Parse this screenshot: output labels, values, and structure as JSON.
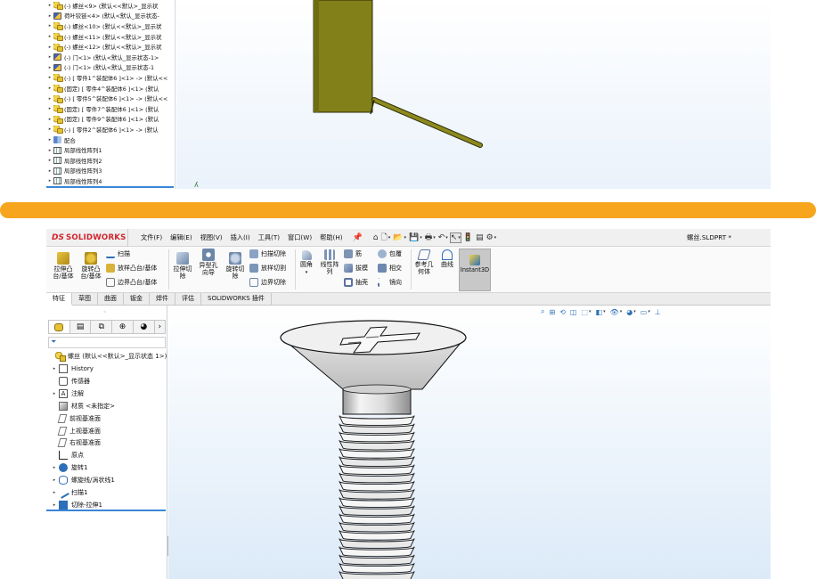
{
  "top_tree": {
    "items": [
      {
        "icon": "bolt",
        "text": "(-) 螺丝<9> (默认<<默认>_显示状"
      },
      {
        "icon": "asm",
        "text": "荷叶铰链<4> (默认<默认_显示状态-"
      },
      {
        "icon": "bolt",
        "text": "(-) 螺丝<10> (默认<<默认>_显示状"
      },
      {
        "icon": "bolt",
        "text": "(-) 螺丝<11> (默认<<默认>_显示状"
      },
      {
        "icon": "bolt",
        "text": "(-) 螺丝<12> (默认<<默认>_显示状"
      },
      {
        "icon": "asm",
        "text": "(-) 门<1> (默认<默认_显示状态-1>"
      },
      {
        "icon": "asm",
        "text": "(-) 门<1> (默认<默认_显示状态-1"
      },
      {
        "icon": "bolt",
        "text": "(-) [ 零件1^装配体6 ]<1> -> (默认<<"
      },
      {
        "icon": "bolt",
        "text": "(固定) [ 零件4^装配体6 ]<1> (默认"
      },
      {
        "icon": "bolt",
        "text": "(-) [ 零件5^装配体6 ]<1> -> (默认<<"
      },
      {
        "icon": "bolt",
        "text": "(固定) [ 零件7^装配体6 ]<1> (默认"
      },
      {
        "icon": "bolt",
        "text": "(固定) [ 零件9^装配体6 ]<1> (默认"
      },
      {
        "icon": "bolt",
        "text": "(-) [ 零件2^装配体6 ]<1> -> (默认"
      },
      {
        "icon": "mate",
        "text": "配合"
      },
      {
        "icon": "pattern",
        "text": "局部线性阵列1"
      },
      {
        "icon": "pattern",
        "text": "局部线性阵列2"
      },
      {
        "icon": "pattern",
        "text": "局部线性阵列3"
      },
      {
        "icon": "pattern",
        "text": "局部线性阵列4"
      }
    ]
  },
  "colors": {
    "divider": "#f7a51c",
    "brand": "#d1262f",
    "rod": "#8c8a1e",
    "accent": "#2d6fb8"
  },
  "app": {
    "logo_ds": "DS",
    "logo_name": "SOLIDWORKS",
    "doc_title": "螺丝.SLDPRT *"
  },
  "menu": [
    "文件(F)",
    "编辑(E)",
    "视图(V)",
    "插入(I)",
    "工具(T)",
    "窗口(W)",
    "帮助(H)"
  ],
  "ribbon": {
    "extrude_boss": "拉伸凸\n台/基体",
    "revolve_boss": "旋转凸\n台/基体",
    "sweep": "扫描",
    "loft_boss": "放样凸台/基体",
    "boundary_boss": "边界凸台/基体",
    "extrude_cut": "拉伸切\n除",
    "hole_wizard": "异型孔\n向导",
    "revolve_cut": "旋转切\n除",
    "sweep_cut": "扫描切除",
    "loft_cut": "放样切割",
    "boundary_cut": "边界切除",
    "fillet": "圆角",
    "linear_pattern": "线性阵\n列",
    "rib": "筋",
    "draft": "拔模",
    "shell": "抽壳",
    "wrap": "包覆",
    "intersect": "相交",
    "mirror": "镜向",
    "ref_geometry": "参考几\n何体",
    "curves": "曲线",
    "instant3d": "Instant3D"
  },
  "tabs": [
    "特征",
    "草图",
    "曲面",
    "钣金",
    "焊件",
    "评估",
    "SOLIDWORKS 插件"
  ],
  "feature_tree": {
    "root": "螺丝  (默认<<默认>_显示状态 1>)",
    "items": [
      {
        "icon": "box",
        "text": "History",
        "arrow": true
      },
      {
        "icon": "sensor",
        "text": "传感器",
        "arrow": false
      },
      {
        "icon": "annot",
        "text": "注解",
        "arrow": true
      },
      {
        "icon": "mat",
        "text": "材质 <未指定>",
        "arrow": false
      },
      {
        "icon": "plane",
        "text": "前视基准面",
        "arrow": false
      },
      {
        "icon": "plane",
        "text": "上视基准面",
        "arrow": false
      },
      {
        "icon": "plane",
        "text": "右视基准面",
        "arrow": false
      },
      {
        "icon": "origin",
        "text": "原点",
        "arrow": false
      },
      {
        "icon": "rev",
        "text": "旋转1",
        "arrow": true
      },
      {
        "icon": "helix",
        "text": "螺旋线/涡状线1",
        "arrow": true
      },
      {
        "icon": "sweep",
        "text": "扫描1",
        "arrow": true
      },
      {
        "icon": "cut",
        "text": "切除-拉伸1",
        "arrow": true
      }
    ]
  }
}
